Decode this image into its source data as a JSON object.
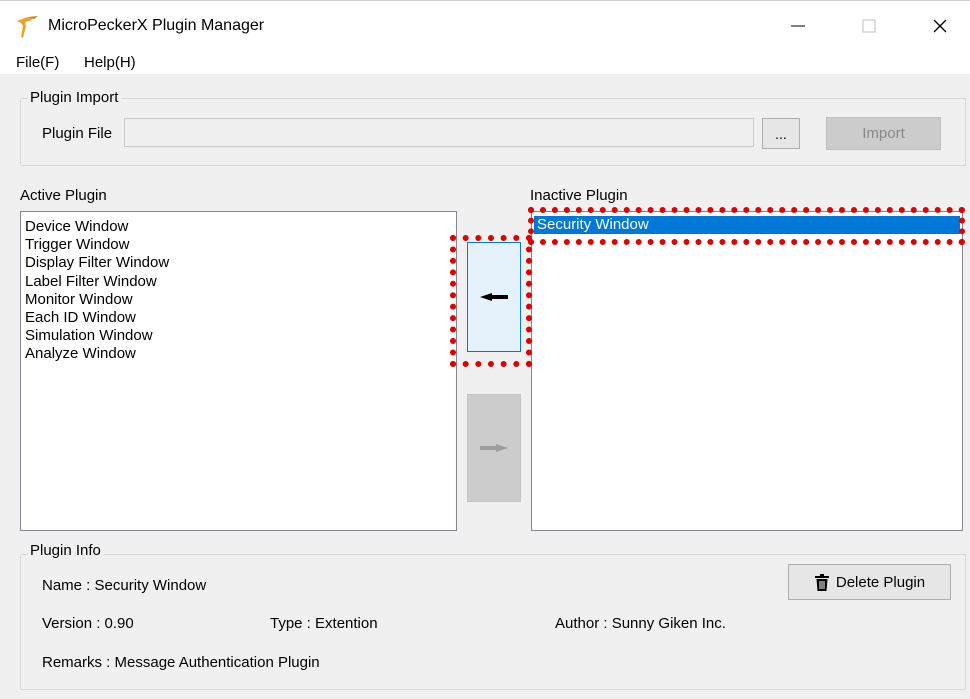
{
  "window": {
    "title": "MicroPeckerX Plugin Manager",
    "minimize_glyph": "—",
    "close_glyph": "✕",
    "app_icon": "woodpecker-logo-icon"
  },
  "menu": {
    "file": "File(F)",
    "help": "Help(H)"
  },
  "plugin_import": {
    "group_label": "Plugin Import",
    "file_label": "Plugin File",
    "file_value": "",
    "browse_label": "...",
    "import_label": "Import"
  },
  "active_plugin": {
    "label": "Active Plugin",
    "items": [
      "Device Window",
      "Trigger Window",
      "Display Filter Window",
      "Label Filter Window",
      "Monitor Window",
      "Each ID Window",
      "Simulation Window",
      "Analyze Window"
    ]
  },
  "inactive_plugin": {
    "label": "Inactive Plugin",
    "items": [
      "Security Window"
    ],
    "selected": "Security Window"
  },
  "transfer": {
    "move_left_icon": "arrow-left-icon",
    "move_right_icon": "arrow-right-icon"
  },
  "plugin_info": {
    "group_label": "Plugin Info",
    "name": "Name : Security Window",
    "version": "Version : 0.90",
    "type": "Type : Extention",
    "author": "Author : Sunny Giken Inc.",
    "remarks": "Remarks : Message Authentication Plugin",
    "delete_label": "Delete Plugin",
    "delete_icon": "trash-icon"
  },
  "colors": {
    "selection": "#0078d7",
    "highlight": "#e00000",
    "logo": "#f0a020"
  }
}
